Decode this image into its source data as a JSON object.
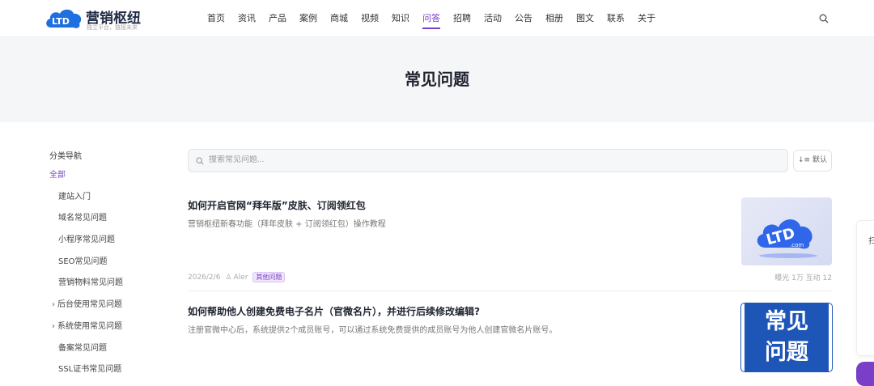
{
  "header": {
    "brand": "营销枢纽",
    "slogan": "独立平台，链接未来",
    "logo_text": "LTD .com",
    "nav": [
      "首页",
      "资讯",
      "产品",
      "案例",
      "商城",
      "视频",
      "知识",
      "问答",
      "招聘",
      "活动",
      "公告",
      "相册",
      "图文",
      "联系",
      "关于"
    ],
    "active_nav": "问答"
  },
  "hero": {
    "title": "常见问题"
  },
  "sidebar": {
    "title": "分类导航",
    "items": [
      {
        "label": "全部"
      },
      {
        "label": "建站入门"
      },
      {
        "label": "域名常见问题"
      },
      {
        "label": "小程序常见问题"
      },
      {
        "label": "SEO常见问题"
      },
      {
        "label": "营销物料常见问题"
      },
      {
        "label": "后台使用常见问题"
      },
      {
        "label": "系统使用常见问题"
      },
      {
        "label": "备案常见问题"
      },
      {
        "label": "SSL证书常见问题"
      }
    ]
  },
  "search": {
    "placeholder": "搜索常见问题...",
    "sort_label": "默认"
  },
  "posts": [
    {
      "title": "如何开启官网“拜年版”皮肤、订阅领红包",
      "desc": "营销枢纽新春功能（拜年皮肤 + 订阅领红包）操作教程",
      "date": "2026/2/6",
      "author": "Aler",
      "tag": "其他问题",
      "stats": "曝光 1万  互动 12"
    },
    {
      "title": "如何帮助他人创建免费电子名片（官微名片），并进行后续修改编辑?",
      "desc": "注册官微中心后，系统提供2个成员账号，可以通过系统免费提供的成员账号为他人创建官微名片账号。",
      "thumb_text_1": "常见",
      "thumb_text_2": "问题"
    }
  ],
  "float_panel": {
    "text": "扫"
  },
  "colors": {
    "accent": "#7a3fc8",
    "thumb_blue": "#1e56b8"
  }
}
